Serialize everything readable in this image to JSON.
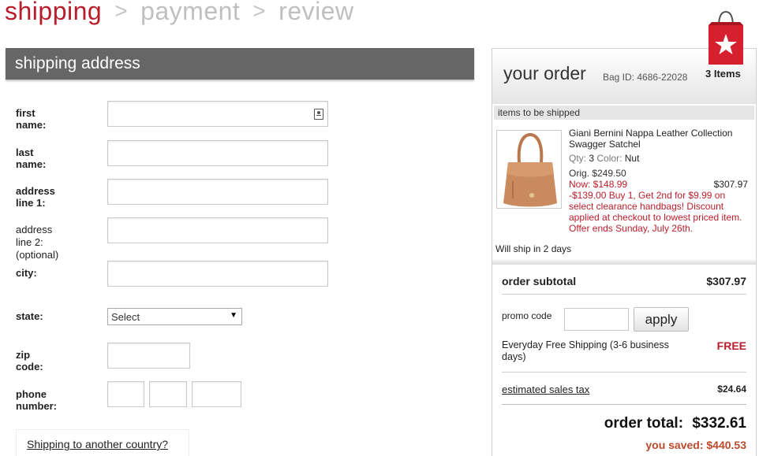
{
  "steps": {
    "shipping": "shipping",
    "payment": "payment",
    "review": "review",
    "separator": ">"
  },
  "shipping_address": {
    "title": "shipping address",
    "fields": {
      "first_name": "first name:",
      "last_name": "last name:",
      "address_line_1": "address line 1:",
      "address_line_2": "address line 2:",
      "address_line_2_note": "(optional)",
      "city": "city:",
      "state": "state:",
      "zip_code": "zip code:",
      "phone_number": "phone number:"
    },
    "state_select_value": "Select",
    "another_country_link": "Shipping to another country?"
  },
  "order": {
    "title": "your order",
    "bag_id": "Bag ID: 4686-22028",
    "items_count": "3 Items",
    "items_band": "items to be shipped",
    "product": {
      "name": "Giani Bernini Nappa Leather Collection Swagger Satchel",
      "qty_label": "Qty:",
      "qty": "3",
      "color_label": "Color:",
      "color": "Nut",
      "orig": "Orig. $249.50",
      "now": "Now: $148.99",
      "line_total": "$307.97",
      "promo": "-$139.00 Buy 1, Get 2nd for $9.99 on select clearance handbags! Discount applied at checkout to lowest priced item. Offer ends Sunday, July 26th."
    },
    "will_ship": "Will ship in 2 days",
    "subtotal_label": "order subtotal",
    "subtotal_value": "$307.97",
    "promo_label": "promo code",
    "promo_value": "",
    "apply_label": "apply",
    "shipping_label": "Everyday Free Shipping (3-6 business days)",
    "shipping_value": "FREE",
    "tax_label": "estimated sales tax",
    "tax_value": "$24.64",
    "total_label": "order total:",
    "total_value": "$332.61",
    "saved_label": "you saved:",
    "saved_value": "$440.53"
  },
  "colors": {
    "accent_red": "#b91d2b",
    "header_gray": "#666666"
  },
  "icons": {
    "contact_card": "contact-card-icon",
    "dropdown": "chevron-down-icon",
    "bag": "shopping-bag-star-icon"
  }
}
